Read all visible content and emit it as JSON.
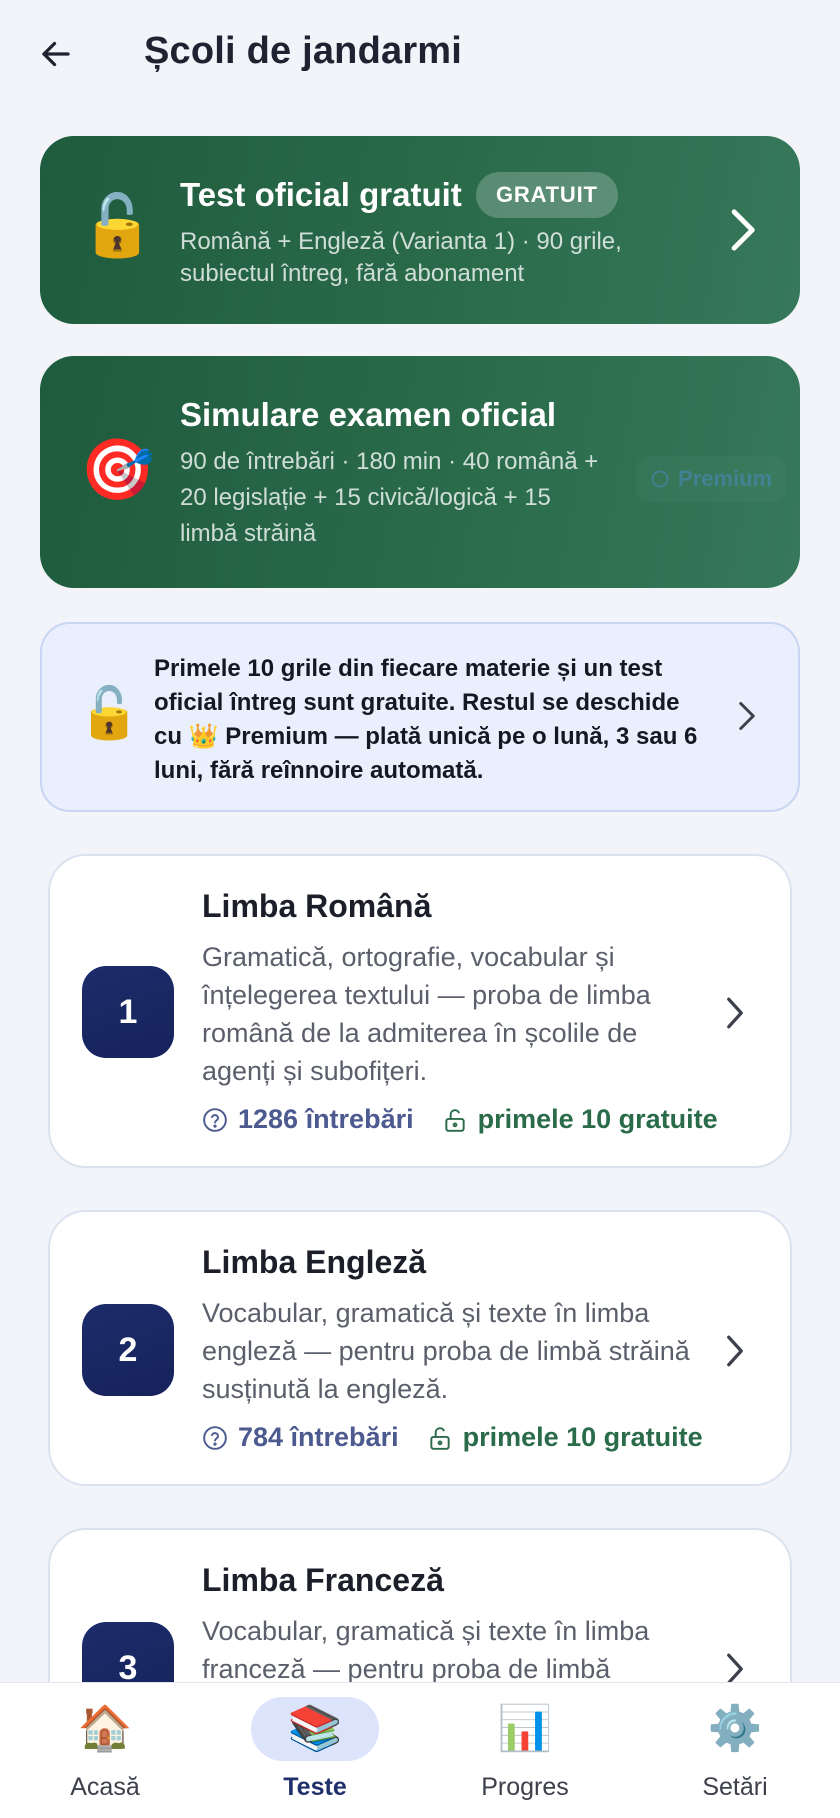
{
  "header": {
    "title": "Școli de jandarmi",
    "back_icon": "arrow-left-icon"
  },
  "free_test": {
    "icon": "🔓",
    "title": "Test oficial gratuit",
    "badge": "GRATUIT",
    "subtitle": "Română + Engleză (Varianta 1) · 90 grile, subiectul întreg, fără abonament"
  },
  "simulation": {
    "icon": "🎯",
    "title": "Simulare examen oficial",
    "subtitle": "90 de întrebări · 180 min · 40 română + 20 legislație + 15 civică/logică + 15 limbă străină",
    "premium_label": "Premium"
  },
  "info": {
    "icon": "🔓",
    "text": "Primele 10 grile din fiecare materie și un test oficial întreg sunt gratuite. Restul se deschide cu 👑 Premium — plată unică pe o lună, 3 sau 6 luni, fără reînnoire automată."
  },
  "subjects": [
    {
      "number": "1",
      "title": "Limba Română",
      "description": "Gramatică, ortografie, vocabular și înțelegerea textului — proba de limba română de la admiterea în școlile de agenți și subofițeri.",
      "questions": "1286 întrebări",
      "free": "primele 10 gratuite"
    },
    {
      "number": "2",
      "title": "Limba Engleză",
      "description": "Vocabular, gramatică și texte în limba engleză — pentru proba de limbă străină susținută la engleză.",
      "questions": "784 întrebări",
      "free": "primele 10 gratuite"
    },
    {
      "number": "3",
      "title": "Limba Franceză",
      "description": "Vocabular, gramatică și texte în limba franceză — pentru proba de limbă"
    }
  ],
  "nav": {
    "items": [
      {
        "label": "Acasă",
        "icon": "🏠"
      },
      {
        "label": "Teste",
        "icon": "📚"
      },
      {
        "label": "Progres",
        "icon": "📊"
      },
      {
        "label": "Setări",
        "icon": "⚙️"
      }
    ],
    "active_index": 1
  },
  "colors": {
    "card_green": "#2a6b4a",
    "accent_blue": "#1f2f6b",
    "free_green": "#2a6b4a",
    "question_blue": "#4c5a8f"
  }
}
